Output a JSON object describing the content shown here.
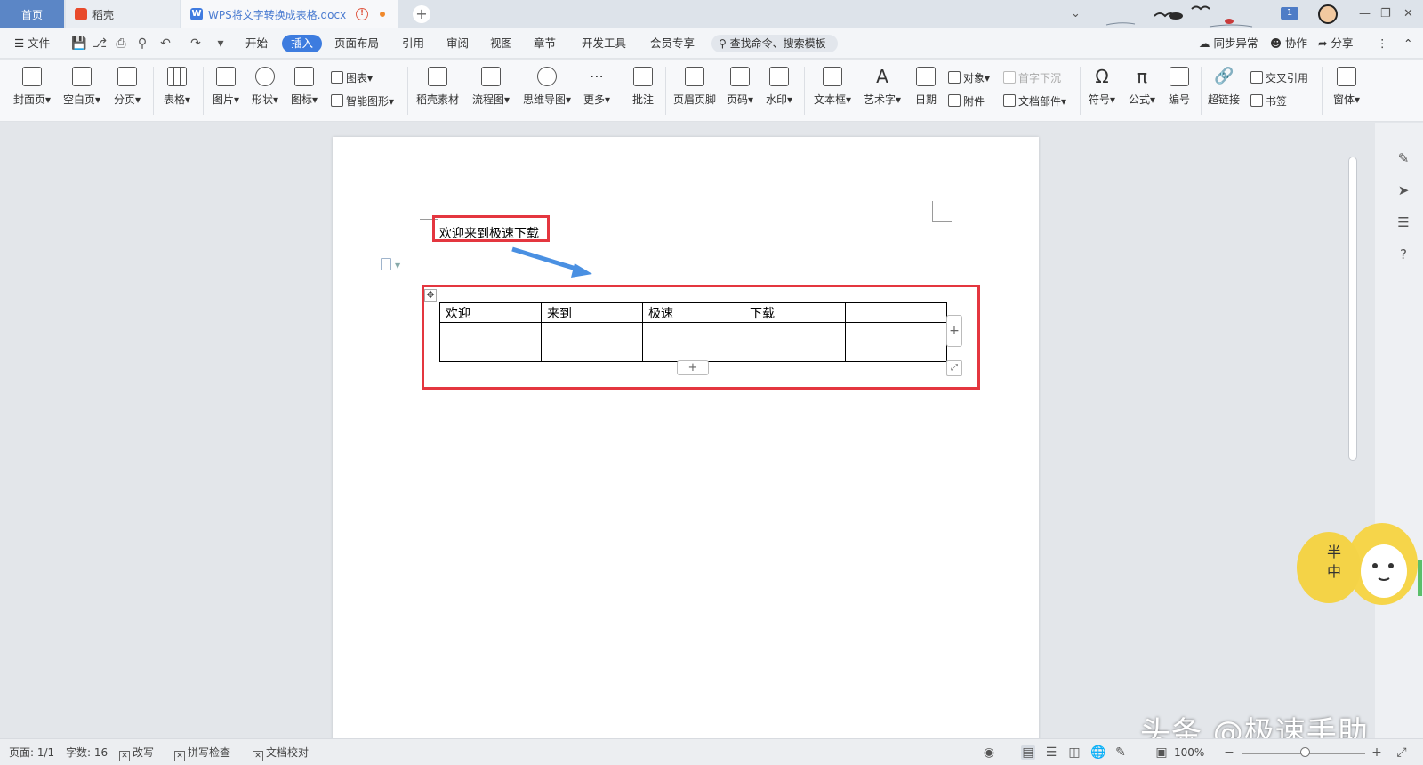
{
  "titlebar": {
    "tabs": [
      {
        "label": "首页"
      },
      {
        "label": "稻壳"
      },
      {
        "label": "WPS将文字转换成表格.docx"
      }
    ],
    "doc_icon_letter": "W",
    "notification_count": "1"
  },
  "menubar": {
    "file": "文件",
    "items": [
      "开始",
      "插入",
      "页面布局",
      "引用",
      "审阅",
      "视图",
      "章节",
      "开发工具",
      "会员专享"
    ],
    "active_item": "插入",
    "search_label": "查找命令、搜索模板",
    "sync": "同步异常",
    "collab": "协作",
    "share": "分享"
  },
  "ribbon": {
    "cover": "封面页",
    "blank": "空白页",
    "pagebreak": "分页",
    "table": "表格",
    "picture": "图片",
    "shape": "形状",
    "icon": "图标",
    "chart": "图表",
    "smartart": "智能图形",
    "daoke": "稻壳素材",
    "flow": "流程图",
    "mindmap": "思维导图",
    "more": "更多",
    "comment": "批注",
    "header_footer": "页眉页脚",
    "page_number": "页码",
    "watermark": "水印",
    "textbox": "文本框",
    "wordart": "艺术字",
    "date": "日期",
    "object": "对象",
    "attachment": "附件",
    "dropcap": "首字下沉",
    "docparts": "文档部件",
    "symbol": "符号",
    "formula": "公式",
    "numbering": "编号",
    "hyperlink": "超链接",
    "crossref": "交叉引用",
    "bookmark": "书签",
    "window": "窗体"
  },
  "document": {
    "text_line": "欢迎来到极速下载",
    "table": {
      "rows": [
        [
          "欢迎",
          "来到",
          "极速",
          "下载",
          ""
        ],
        [
          "",
          "",
          "",
          "",
          ""
        ],
        [
          "",
          "",
          "",
          "",
          ""
        ]
      ]
    }
  },
  "statusbar": {
    "page": "页面: 1/1",
    "wordcount": "字数: 16",
    "revise": "改写",
    "spellcheck": "拼写检查",
    "proofread": "文档校对",
    "zoom": "100%"
  },
  "watermark_text": "头条 @极速手助",
  "mascot_text": [
    "半",
    "中"
  ],
  "colors": {
    "accent": "#3d7cdf",
    "highlight": "#e4363f",
    "arrow": "#4a90e2"
  }
}
